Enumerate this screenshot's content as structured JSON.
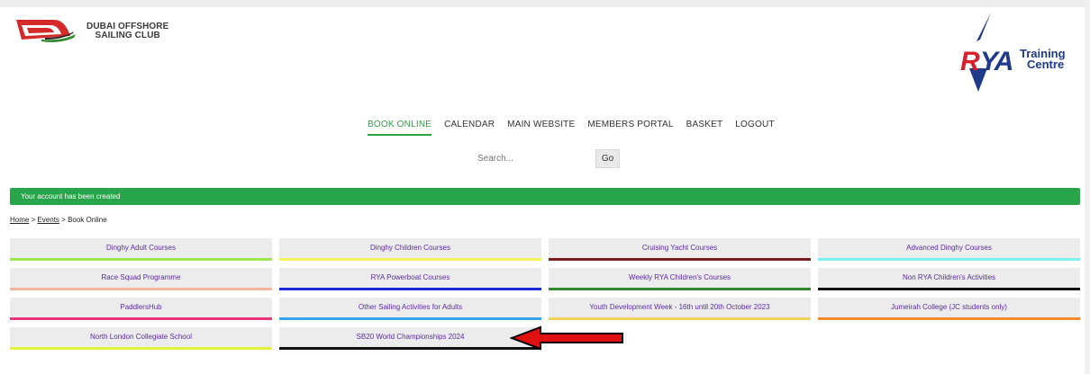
{
  "logo": {
    "line1": "DUBAI OFFSHORE",
    "line2": "SAILING CLUB"
  },
  "rya": {
    "mark_r": "R",
    "mark_ya": "YA",
    "line1": "Training",
    "line2": "Centre"
  },
  "nav": [
    "BOOK ONLINE",
    "CALENDAR",
    "MAIN WEBSITE",
    "MEMBERS PORTAL",
    "BASKET",
    "LOGOUT"
  ],
  "search": {
    "placeholder": "Search...",
    "go_label": "Go"
  },
  "alert": "Your account has been created",
  "breadcrumb": {
    "home": "Home",
    "sep1": " > ",
    "events": "Events",
    "sep2": " > ",
    "current": "Book Online"
  },
  "categories": [
    {
      "label": "Dinghy Adult Courses",
      "color": "#9be84a"
    },
    {
      "label": "Dinghy Children Courses",
      "color": "#f2f25a"
    },
    {
      "label": "Cruising Yacht Courses",
      "color": "#7a1f1f"
    },
    {
      "label": "Advanced Dinghy Courses",
      "color": "#7cf0f0"
    },
    {
      "label": "Race Squad Programme",
      "color": "#f4b49a"
    },
    {
      "label": "RYA Powerboat Courses",
      "color": "#1a2ad8"
    },
    {
      "label": "Weekly RYA Children's Courses",
      "color": "#2f8a2f"
    },
    {
      "label": "Non RYA Children's Activities",
      "color": "#111111"
    },
    {
      "label": "PaddlersHub",
      "color": "#e8347a"
    },
    {
      "label": "Other Sailing Activities for Adults",
      "color": "#3aa4e8"
    },
    {
      "label": "Youth Development Week - 16th until 20th October 2023",
      "color": "#f2d25a"
    },
    {
      "label": "Jumeirah College (JC students only)",
      "color": "#f08a2a"
    },
    {
      "label": "North London Collegiate School",
      "color": "#e4f23a"
    },
    {
      "label": "SB20 World Championships 2024",
      "color": "#111111"
    }
  ],
  "colors": {
    "alert_green": "#28a44a",
    "nav_active": "#2ea043",
    "link_purple": "#5b2aa6",
    "arrow_red": "#e01010"
  }
}
